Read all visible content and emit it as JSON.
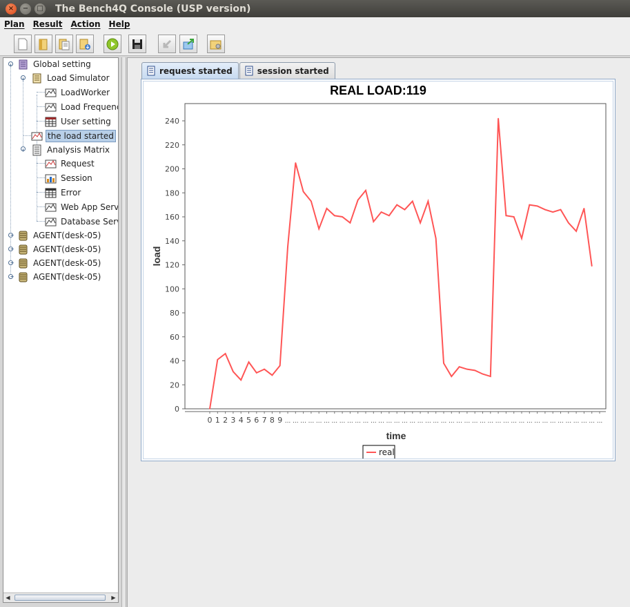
{
  "window": {
    "title": "The Bench4Q Console (USP version)"
  },
  "menu": [
    "Plan",
    "Result",
    "Action",
    "Help"
  ],
  "toolbar_icons": [
    "new-document-icon",
    "open-folder-icon",
    "copy-document-icon",
    "import-icon",
    "run-icon",
    "save-icon",
    "back-arrow-icon",
    "export-icon",
    "settings-folder-icon"
  ],
  "tree": {
    "global": "Global setting",
    "load_simulator": "Load Simulator",
    "load_worker": "LoadWorker",
    "load_frequency": "Load Frequenc",
    "user_setting": "User setting",
    "load_started": "the load started",
    "analysis_matrix": "Analysis Matrix",
    "request": "Request",
    "session": "Session",
    "error": "Error",
    "web_app": "Web App Serve",
    "database": "Database Serv",
    "agents": [
      "AGENT(desk-05)",
      "AGENT(desk-05)",
      "AGENT(desk-05)",
      "AGENT(desk-05)"
    ]
  },
  "tabs": [
    "request started",
    "session started"
  ],
  "chart_data": {
    "type": "line",
    "title": "REAL LOAD:119",
    "xlabel": "time",
    "ylabel": "load",
    "ylim": [
      0,
      250
    ],
    "yticks": [
      0,
      20,
      40,
      60,
      80,
      100,
      120,
      140,
      160,
      180,
      200,
      220,
      240
    ],
    "x_tick_labels": [
      "0",
      "1",
      "2",
      "3",
      "4",
      "5",
      "6",
      "7",
      "8",
      "9",
      "...",
      "...",
      "...",
      "...",
      "...",
      "...",
      "...",
      "...",
      "...",
      "...",
      "...",
      "...",
      "...",
      "...",
      "...",
      "...",
      "...",
      "...",
      "...",
      "...",
      "...",
      "...",
      "...",
      "...",
      "...",
      "...",
      "...",
      "...",
      "...",
      "...",
      "...",
      "...",
      "...",
      "...",
      "...",
      "...",
      "...",
      "...",
      "...",
      "...",
      "..."
    ],
    "legend": "bottom",
    "series": [
      {
        "name": "real",
        "color": "#ff5555",
        "values": [
          0,
          41,
          46,
          31,
          24,
          39,
          30,
          33,
          28,
          36,
          135,
          205,
          181,
          173,
          150,
          167,
          161,
          160,
          155,
          174,
          182,
          156,
          164,
          161,
          170,
          166,
          173,
          155,
          173,
          142,
          38,
          27,
          35,
          33,
          32,
          29,
          27,
          242,
          161,
          160,
          142,
          170,
          169,
          166,
          164,
          166,
          155,
          148,
          167,
          119
        ]
      }
    ]
  }
}
